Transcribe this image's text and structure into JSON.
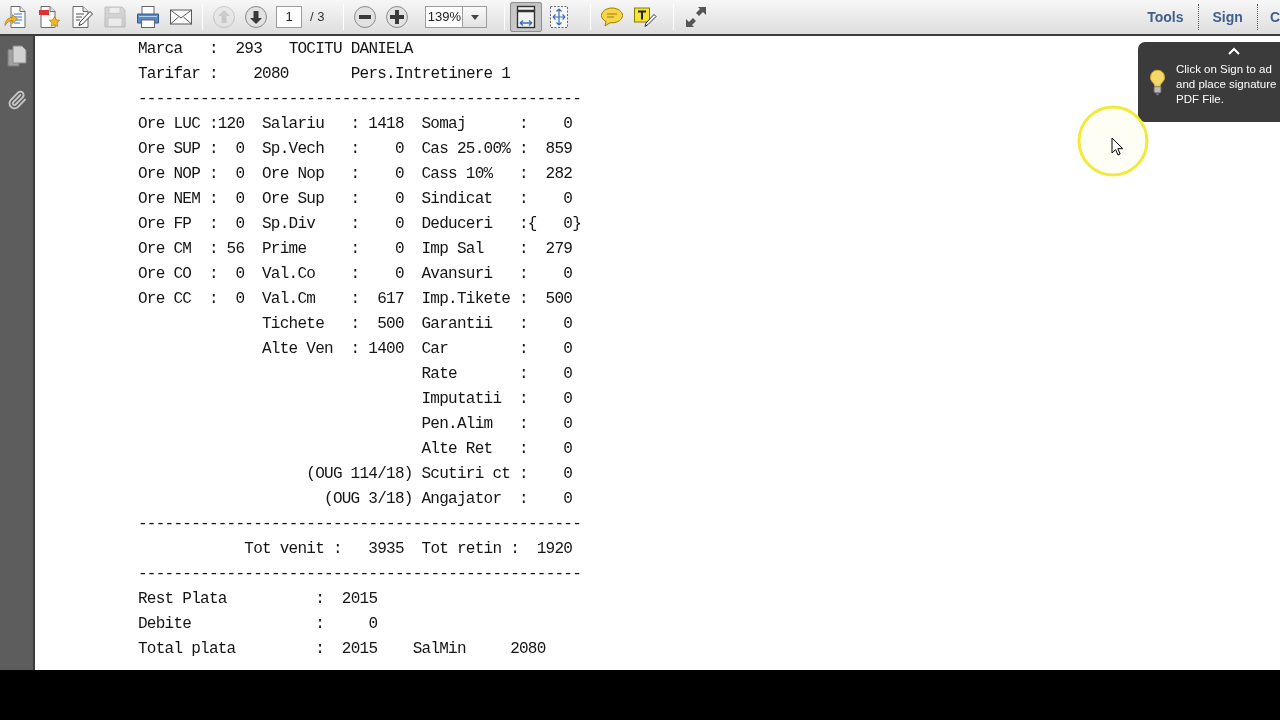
{
  "toolbar": {
    "file_buttons": [
      {
        "kind": "create",
        "disabled": false
      },
      {
        "kind": "create_pdf",
        "disabled": false
      },
      {
        "kind": "sign_document",
        "disabled": false
      },
      {
        "kind": "save",
        "disabled": true
      },
      {
        "kind": "print",
        "disabled": false
      },
      {
        "kind": "email",
        "disabled": false
      }
    ],
    "page_nav": {
      "previous": {
        "disabled": true
      },
      "next": {
        "disabled": false
      },
      "page_field": {
        "value": "1"
      },
      "page_count": "/ 3"
    },
    "zoom": {
      "field": {
        "value": "139%"
      }
    },
    "view_buttons": [
      {
        "kind": "fit_page",
        "selected": true
      },
      {
        "kind": "fit_width",
        "selected": false
      }
    ],
    "annotate_buttons": [
      {
        "kind": "comment"
      },
      {
        "kind": "highlight"
      },
      {
        "kind": "full_screen"
      }
    ],
    "panel_links": [
      {
        "label": "Tools"
      },
      {
        "label": "Sign"
      },
      {
        "label": "C"
      }
    ]
  },
  "sign_tip": {
    "lines": [
      "Click on Sign to ad",
      "and place signature",
      "PDF File."
    ]
  },
  "document": {
    "lines": [
      {
        "kind": "text",
        "text": "Marca   :  293   TOCITU DANIELA"
      },
      {
        "kind": "text",
        "text": "Tarifar :    2080       Pers.Intretinere 1"
      },
      {
        "kind": "rule",
        "text": "--------------------------------------------------"
      },
      {
        "kind": "fields",
        "left": "Ore LUC :120",
        "middle": "Salariu   : 1418",
        "right": "Somaj      :    0"
      },
      {
        "kind": "fields",
        "left": "Ore SUP :  0",
        "middle": "Sp.Vech   :    0",
        "right": "Cas 25.00% :  859"
      },
      {
        "kind": "fields",
        "left": "Ore NOP :  0",
        "middle": "Ore Nop   :    0",
        "right": "Cass 10%   :  282"
      },
      {
        "kind": "fields",
        "left": "Ore NEM :  0",
        "middle": "Ore Sup   :    0",
        "right": "Sindicat   :    0"
      },
      {
        "kind": "fields",
        "left": "Ore FP  :  0",
        "middle": "Sp.Div    :    0",
        "right": "Deduceri   :{   0}"
      },
      {
        "kind": "fields",
        "left": "Ore CM  : 56",
        "middle": "Prime     :    0",
        "right": "Imp Sal    :  279"
      },
      {
        "kind": "fields",
        "left": "Ore CO  :  0",
        "middle": "Val.Co    :    0",
        "right": "Avansuri   :    0"
      },
      {
        "kind": "fields",
        "left": "Ore CC  :  0",
        "middle": "Val.Cm    :  617",
        "right": "Imp.Tikete :  500"
      },
      {
        "kind": "fields",
        "middle": "Tichete   :  500",
        "right": "Garantii   :    0"
      },
      {
        "kind": "fields",
        "middle": "Alte Ven  : 1400",
        "right": "Car        :    0"
      },
      {
        "kind": "fields",
        "right": "Rate       :    0"
      },
      {
        "kind": "fields",
        "right": "Imputatii  :    0"
      },
      {
        "kind": "fields",
        "right": "Pen.Alim   :    0"
      },
      {
        "kind": "fields",
        "right": "Alte Ret   :    0"
      },
      {
        "kind": "fields",
        "note": "(OUG 114/18)",
        "right": "Scutiri ct :    0"
      },
      {
        "kind": "fields",
        "note": "(OUG 3/18)",
        "right": "Angajator  :    0"
      },
      {
        "kind": "rule",
        "text": "--------------------------------------------------"
      },
      {
        "kind": "totals",
        "income": "Tot venit :   3935",
        "deductions": "Tot retin :  1920"
      },
      {
        "kind": "rule",
        "text": "--------------------------------------------------"
      },
      {
        "kind": "summary",
        "text": "Rest Plata          :  2015"
      },
      {
        "kind": "summary",
        "text": "Debite              :     0"
      },
      {
        "kind": "summary",
        "text": "Total plata         :  2015",
        "extra": "SalMin     2080"
      }
    ]
  }
}
